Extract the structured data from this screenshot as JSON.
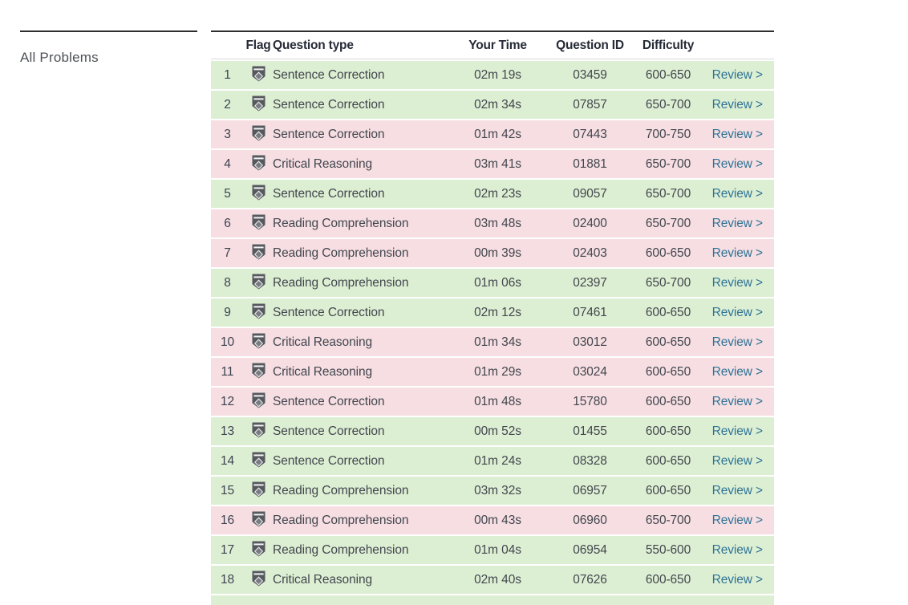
{
  "sidebar": {
    "title": "All Problems"
  },
  "table": {
    "headers": {
      "flag": "Flag",
      "type": "Question type",
      "time": "Your Time",
      "id": "Question ID",
      "difficulty": "Difficulty"
    },
    "review_label": "Review >",
    "colors": {
      "row_green": "#ddefd3",
      "row_pink": "#f6dee2",
      "review_link": "#2e7396",
      "header_text": "#262b37",
      "row_text": "#42464e",
      "rule_dark": "#2d2d2d",
      "divider_light": "#d9d9d9",
      "flag_icon": "#55595e"
    },
    "rows": [
      {
        "num": "1",
        "type": "Sentence Correction",
        "time": "02m 19s",
        "id": "03459",
        "difficulty": "600-650",
        "status": "green"
      },
      {
        "num": "2",
        "type": "Sentence Correction",
        "time": "02m 34s",
        "id": "07857",
        "difficulty": "650-700",
        "status": "green"
      },
      {
        "num": "3",
        "type": "Sentence Correction",
        "time": "01m 42s",
        "id": "07443",
        "difficulty": "700-750",
        "status": "pink"
      },
      {
        "num": "4",
        "type": "Critical Reasoning",
        "time": "03m 41s",
        "id": "01881",
        "difficulty": "650-700",
        "status": "pink"
      },
      {
        "num": "5",
        "type": "Sentence Correction",
        "time": "02m 23s",
        "id": "09057",
        "difficulty": "650-700",
        "status": "green"
      },
      {
        "num": "6",
        "type": "Reading Comprehension",
        "time": "03m 48s",
        "id": "02400",
        "difficulty": "650-700",
        "status": "pink"
      },
      {
        "num": "7",
        "type": "Reading Comprehension",
        "time": "00m 39s",
        "id": "02403",
        "difficulty": "600-650",
        "status": "pink"
      },
      {
        "num": "8",
        "type": "Reading Comprehension",
        "time": "01m 06s",
        "id": "02397",
        "difficulty": "650-700",
        "status": "green"
      },
      {
        "num": "9",
        "type": "Sentence Correction",
        "time": "02m 12s",
        "id": "07461",
        "difficulty": "600-650",
        "status": "green"
      },
      {
        "num": "10",
        "type": "Critical Reasoning",
        "time": "01m 34s",
        "id": "03012",
        "difficulty": "600-650",
        "status": "pink"
      },
      {
        "num": "11",
        "type": "Critical Reasoning",
        "time": "01m 29s",
        "id": "03024",
        "difficulty": "600-650",
        "status": "pink"
      },
      {
        "num": "12",
        "type": "Sentence Correction",
        "time": "01m 48s",
        "id": "15780",
        "difficulty": "600-650",
        "status": "pink"
      },
      {
        "num": "13",
        "type": "Sentence Correction",
        "time": "00m 52s",
        "id": "01455",
        "difficulty": "600-650",
        "status": "green"
      },
      {
        "num": "14",
        "type": "Sentence Correction",
        "time": "01m 24s",
        "id": "08328",
        "difficulty": "600-650",
        "status": "green"
      },
      {
        "num": "15",
        "type": "Reading Comprehension",
        "time": "03m 32s",
        "id": "06957",
        "difficulty": "600-650",
        "status": "green"
      },
      {
        "num": "16",
        "type": "Reading Comprehension",
        "time": "00m 43s",
        "id": "06960",
        "difficulty": "650-700",
        "status": "pink"
      },
      {
        "num": "17",
        "type": "Reading Comprehension",
        "time": "01m 04s",
        "id": "06954",
        "difficulty": "550-600",
        "status": "green"
      },
      {
        "num": "18",
        "type": "Critical Reasoning",
        "time": "02m 40s",
        "id": "07626",
        "difficulty": "600-650",
        "status": "green"
      }
    ],
    "partial_row": {
      "status": "green"
    }
  }
}
